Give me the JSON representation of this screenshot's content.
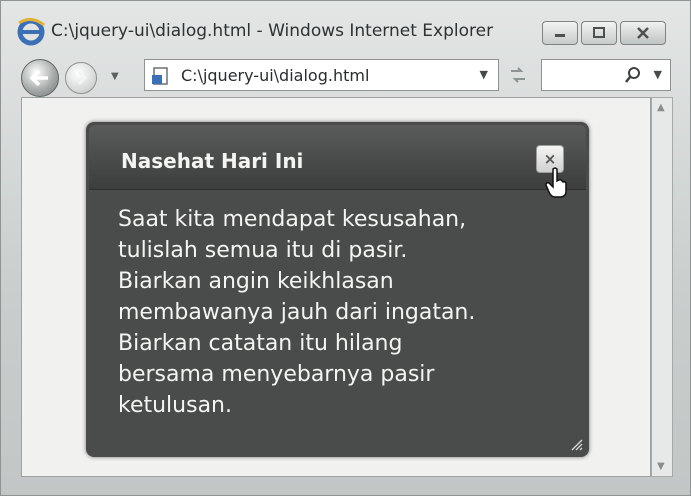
{
  "window": {
    "title": "C:\\jquery-ui\\dialog.html - Windows Internet Explorer"
  },
  "toolbar": {
    "address": "C:\\jquery-ui\\dialog.html"
  },
  "dialog": {
    "title": "Nasehat Hari Ini",
    "close_glyph": "×",
    "body_lines": [
      "Saat kita mendapat kesusahan,",
      "tulislah semua itu di pasir.",
      "Biarkan angin keikhlasan",
      "membawanya jauh dari ingatan.",
      "Biarkan catatan itu hilang",
      "bersama menyebarnya pasir",
      "ketulusan."
    ]
  },
  "icons": {
    "browser": "ie-logo-icon",
    "back": "back-arrow-icon",
    "forward": "forward-arrow-icon",
    "page": "page-icon",
    "refresh": "refresh-icon",
    "search": "search-icon",
    "minimize": "minimize-icon",
    "maximize": "maximize-icon",
    "close": "close-icon",
    "cursor": "hand-cursor-icon",
    "resize": "resize-grip-icon"
  },
  "colors": {
    "dialog_background": "#4a4c4b",
    "dialog_text": "#f4f4f2",
    "chrome": "#c9cdcc"
  }
}
